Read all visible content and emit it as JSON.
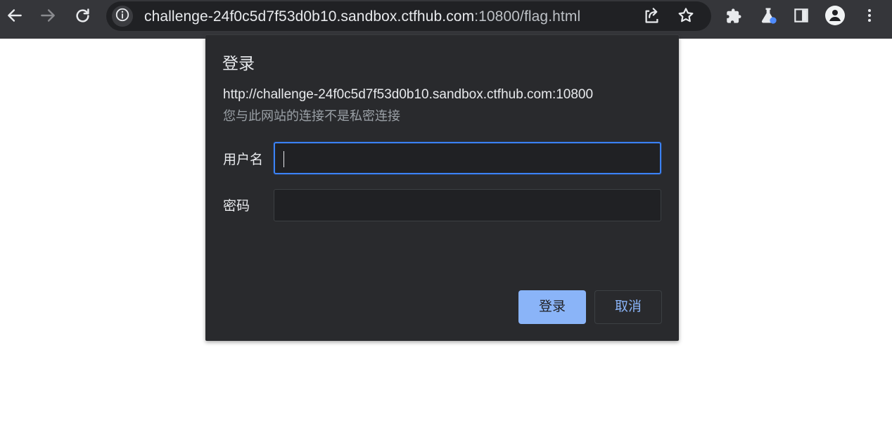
{
  "browser": {
    "url_host": "challenge-24f0c5d7f53d0b10.sandbox.ctfhub.com",
    "url_port_path": ":10800/flag.html",
    "icons": {
      "back": "arrow-left-icon",
      "forward": "arrow-right-icon",
      "reload": "reload-icon",
      "site_info": "info-icon",
      "share": "share-icon",
      "bookmark": "star-icon",
      "extensions": "puzzle-icon",
      "labs": "flask-icon",
      "side_panel": "side-panel-icon",
      "profile": "person-icon",
      "menu": "three-dots-vertical-icon"
    }
  },
  "dialog": {
    "title": "登录",
    "origin": "http://challenge-24f0c5d7f53d0b10.sandbox.ctfhub.com:10800",
    "security_note": "您与此网站的连接不是私密连接",
    "username": {
      "label": "用户名",
      "value": ""
    },
    "password": {
      "label": "密码",
      "value": ""
    },
    "buttons": {
      "sign_in": "登录",
      "cancel": "取消"
    }
  },
  "colors": {
    "toolbar": "#35363a",
    "omnibox": "#202124",
    "dialog": "#292a2d",
    "focus_border": "#3b82f6",
    "primary_button": "#8ab4f8",
    "text": "#e8eaed",
    "secondary_text": "#9aa0a6"
  }
}
